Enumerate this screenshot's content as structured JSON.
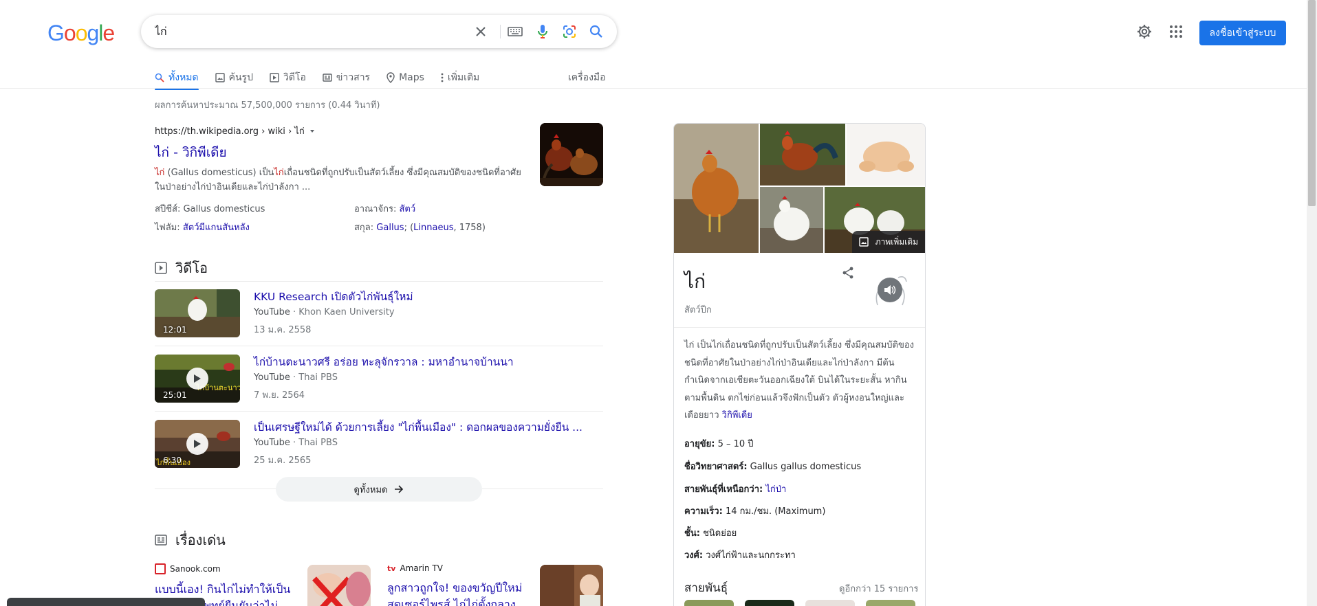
{
  "logo": {
    "letters": [
      "G",
      "o",
      "o",
      "g",
      "l",
      "e"
    ],
    "colors": [
      "#4285F4",
      "#EA4335",
      "#FBBC05",
      "#4285F4",
      "#34A853",
      "#EA4335"
    ]
  },
  "search": {
    "query": "ไก่"
  },
  "header": {
    "signin_label": "ลงชื่อเข้าสู่ระบบ"
  },
  "tabs": [
    {
      "label": "ทั้งหมด",
      "icon": "search-icon",
      "active": true
    },
    {
      "label": "ค้นรูป",
      "icon": "image-icon"
    },
    {
      "label": "วิดีโอ",
      "icon": "video-icon"
    },
    {
      "label": "ข่าวสาร",
      "icon": "news-icon"
    },
    {
      "label": "Maps",
      "icon": "map-pin-icon"
    },
    {
      "label": "เพิ่มเติม",
      "icon": "more-vert-icon"
    }
  ],
  "tools_label": "เครื่องมือ",
  "stats": "ผลการค้นหาประมาณ 57,500,000 รายการ (0.44 วินาที)",
  "wiki": {
    "cite": "https://th.wikipedia.org › wiki › ไก่",
    "title": "ไก่ - วิกิพีเดีย",
    "snippet_pre": "ไก่",
    "snippet_mid1": " (Gallus domesticus) เป็น",
    "snippet_hl": "ไก่",
    "snippet_post": "เถื่อนชนิดที่ถูกปรับเป็นสัตว์เลี้ยง ซึ่งมีคุณสมบัติของชนิดที่อาศัยในป่าอย่างไก่ป่าอินเดียและไก่ป่าลังกา ...",
    "facts": {
      "species_label": "สปีชีส์:",
      "species_value": "Gallus domesticus",
      "kingdom_label": "อาณาจักร:",
      "kingdom_value": "สัตว์",
      "phylum_label": "ไฟลัม:",
      "phylum_value": "สัตว์มีแกนสันหลัง",
      "genus_label": "สกุล:",
      "genus_value": "Gallus",
      "genus_sep": "; (",
      "genus_author": "Linnaeus",
      "genus_year": ", 1758)"
    }
  },
  "videos": {
    "heading": "วิดีโอ",
    "items": [
      {
        "title": "KKU Research เปิดตัวไก่พันธุ์ใหม่",
        "source": "YouTube",
        "channel": "· Khon Kaen University",
        "date": "13 ม.ค. 2558",
        "duration": "12:01"
      },
      {
        "title": "ไก่บ้านตะนาวศรี อร่อย ทะลุจักรวาล : มหาอำนาจบ้านนา",
        "source": "YouTube",
        "channel": "· Thai PBS",
        "date": "7 พ.ย. 2564",
        "duration": "25:01"
      },
      {
        "title": "เป็นเศรษฐีใหม่ได้ ด้วยการเลี้ยง \"ไก่พื้นเมือง\" : ดอกผลของความยั่งยืน ...",
        "source": "YouTube",
        "channel": "· Thai PBS",
        "date": "25 ม.ค. 2565",
        "duration": "6:30"
      }
    ],
    "view_all": "ดูทั้งหมด"
  },
  "top_stories": {
    "heading": "เรื่องเด่น",
    "items": [
      {
        "source": "Sanook.com",
        "headline": "แบบนี้เอง! กินไก่ไม่ทำให้เป็นแผลเป็น แพทย์ยืนยันว่าไม่เกี่ยว"
      },
      {
        "source": "Amarin TV",
        "headline": "ลูกสาวถูกใจ! ของขวัญปีใหม่สุดเซอร์ไพรส์ ไก่ไก่ตั้งกลางบ้าน"
      }
    ]
  },
  "kp": {
    "title": "ไก่",
    "subtitle": "สัตว์ปีก",
    "more_images": "ภาพเพิ่มเติม",
    "description": "ไก่ เป็นไก่เถื่อนชนิดที่ถูกปรับเป็นสัตว์เลี้ยง ซึ่งมีคุณสมบัติของชนิดที่อาศัยในป่าอย่างไก่ป่าอินเดียและไก่ป่าลังกา มีต้นกำเนิดจากเอเชียตะวันออกเฉียงใต้ บินได้ในระยะสั้น หากินตามพื้นดิน ตกไข่ก่อนแล้วจึงฟักเป็นตัว ตัวผู้หงอนใหญ่และเดือยยาว ",
    "desc_link": "วิกิพีเดีย",
    "facts": [
      {
        "label": "อายุขัย:",
        "value": "5 – 10 ปี"
      },
      {
        "label": "ชื่อวิทยาศาสตร์:",
        "value": "Gallus gallus domesticus"
      },
      {
        "label": "สายพันธุ์ที่เหนือกว่า:",
        "value": "ไก่ป่า",
        "link": true
      },
      {
        "label": "ความเร็ว:",
        "value": "14 กม./ชม. (Maximum)"
      },
      {
        "label": "ชั้น:",
        "value": "ชนิดย่อย"
      },
      {
        "label": "วงศ์:",
        "value": "วงศ์ไก่ฟ้าและนกกระทา"
      }
    ],
    "breeds_heading": "สายพันธุ์",
    "breeds_more": "ดูอีกกว่า 15 รายการ"
  }
}
